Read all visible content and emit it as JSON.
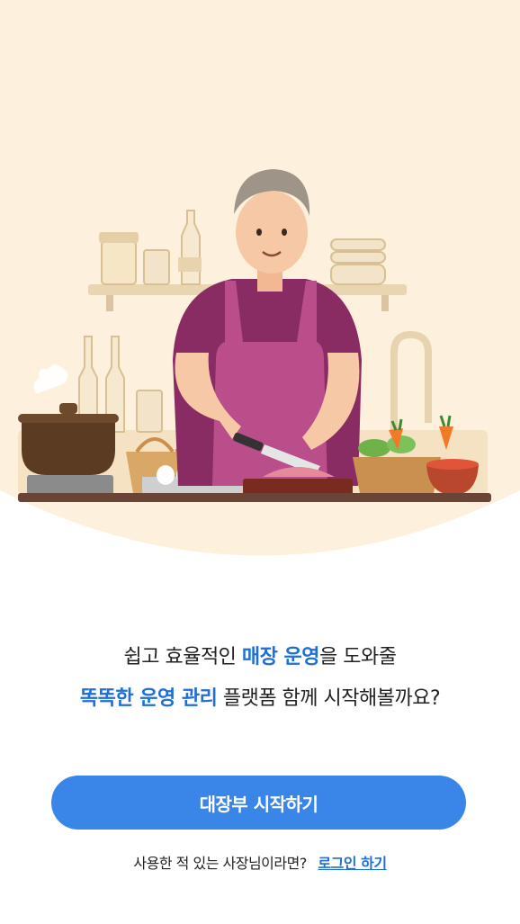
{
  "intro": {
    "line1_prefix": "쉽고 효율적인 ",
    "line1_highlight": "매장 운영",
    "line1_suffix": "을 도와줄",
    "line2_highlight": "똑똑한 운영 관리",
    "line2_suffix": " 플랫폼 함께 시작해볼까요?"
  },
  "actions": {
    "start_label": "대장부 시작하기",
    "login_prompt": "사용한 적 있는 사장님이라면?",
    "login_label": "로그인 하기"
  },
  "colors": {
    "accent": "#3a86e8",
    "highlight_text": "#1f6fd6",
    "hero_background": "#fdf0dc"
  },
  "illustration": {
    "subject": "chef-cooking-illustration"
  }
}
